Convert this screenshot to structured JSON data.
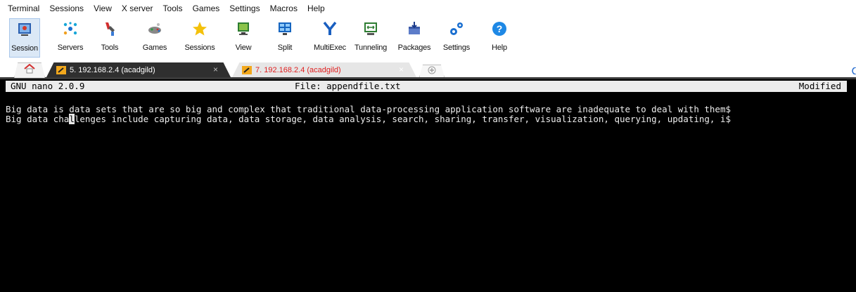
{
  "menubar": {
    "items": [
      {
        "label": "Terminal"
      },
      {
        "label": "Sessions"
      },
      {
        "label": "View"
      },
      {
        "label": "X server"
      },
      {
        "label": "Tools"
      },
      {
        "label": "Games"
      },
      {
        "label": "Settings"
      },
      {
        "label": "Macros"
      },
      {
        "label": "Help"
      }
    ]
  },
  "toolbar": {
    "items": [
      {
        "label": "Session",
        "icon": "session-icon",
        "active": true
      },
      {
        "label": "Servers",
        "icon": "servers-icon"
      },
      {
        "label": "Tools",
        "icon": "tools-icon"
      },
      {
        "label": "Games",
        "icon": "games-icon"
      },
      {
        "label": "Sessions",
        "icon": "star-icon"
      },
      {
        "label": "View",
        "icon": "view-icon"
      },
      {
        "label": "Split",
        "icon": "split-icon"
      },
      {
        "label": "MultiExec",
        "icon": "multiexec-icon"
      },
      {
        "label": "Tunneling",
        "icon": "tunneling-icon"
      },
      {
        "label": "Packages",
        "icon": "packages-icon"
      },
      {
        "label": "Settings",
        "icon": "gears-icon"
      },
      {
        "label": "Help",
        "icon": "help-icon"
      }
    ]
  },
  "tabs": [
    {
      "label": "5. 192.168.2.4 (acadgild)",
      "active": true,
      "close": "×"
    },
    {
      "label": "7. 192.168.2.4 (acadgild)",
      "active": false,
      "close": "×"
    }
  ],
  "terminal": {
    "header_left": "GNU nano 2.0.9",
    "header_center": "File: appendfile.txt",
    "header_right": "Modified",
    "line1": "Big data is data sets that are so big and complex that traditional data-processing application software are inadequate to deal with them$",
    "line2_before_cursor": "Big data cha",
    "line2_cursor": "l",
    "line2_after_cursor": "lenges include capturing data, data storage, data analysis, search, sharing, transfer, visualization, querying, updating, i$"
  },
  "colors": {
    "terminal_bg": "#000000",
    "header_bg": "#ececec",
    "active_tab_bg": "#2f2f2f",
    "inactive_tab_text": "#e02020"
  }
}
